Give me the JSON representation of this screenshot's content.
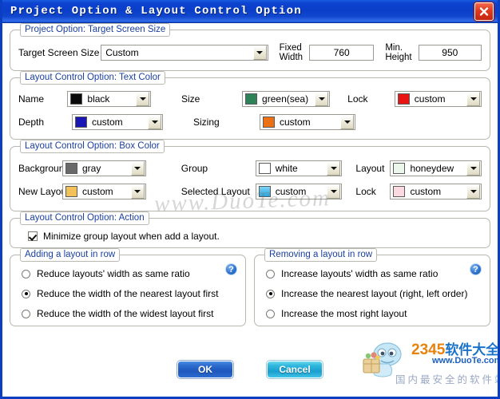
{
  "window": {
    "title": "Project Option & Layout Control Option",
    "close_icon": "close-icon"
  },
  "project_option": {
    "legend": "Project Option: Target Screen Size",
    "target_screen_size_label": "Target Screen Size",
    "target_screen_size_value": "Custom",
    "fixed_width_label": "Fixed\nWidth",
    "fixed_width_label_line1": "Fixed",
    "fixed_width_label_line2": "Width",
    "fixed_width_value": "760",
    "min_height_label_line1": "Min.",
    "min_height_label_line2": "Height",
    "min_height_value": "950"
  },
  "text_color": {
    "legend": "Layout Control Option: Text Color",
    "fields": [
      {
        "label": "Name",
        "value": "black",
        "color": "#0a0a0a"
      },
      {
        "label": "Size",
        "value": "green(sea)",
        "color": "#2e8257"
      },
      {
        "label": "Lock",
        "value": "custom",
        "color": "#e81313"
      },
      {
        "label": "Depth",
        "value": "custom",
        "color": "#1a16b4"
      },
      {
        "label": "Sizing",
        "value": "custom",
        "color": "#ec7014"
      }
    ]
  },
  "box_color": {
    "legend": "Layout Control Option: Box Color",
    "fields": [
      {
        "label": "Background",
        "value": "gray",
        "color": "#696969"
      },
      {
        "label": "Group",
        "value": "white",
        "color": "#ffffff"
      },
      {
        "label": "Layout",
        "value": "honeydew",
        "color": "#eaf7ea"
      },
      {
        "label": "New Layout",
        "value": "custom",
        "color": "#f2c159"
      },
      {
        "label": "Selected Layout",
        "value": "custom",
        "color": "#46b4e8"
      },
      {
        "label": "Lock",
        "value": "custom",
        "color": "#fadae0"
      }
    ]
  },
  "action": {
    "legend": "Layout Control Option: Action",
    "checkbox_label": "Minimize group layout when add a layout.",
    "checkbox_checked": true
  },
  "adding_group": {
    "legend": "Adding a layout in row",
    "help_icon_label": "?",
    "options": [
      "Reduce layouts' width as same ratio",
      "Reduce the width of the nearest layout first",
      "Reduce the width of the widest layout first"
    ],
    "selected_index": 1
  },
  "removing_group": {
    "legend": "Removing a layout in row",
    "help_icon_label": "?",
    "options": [
      "Increase layouts' width as same ratio",
      "Increase the nearest layout (right, left order)",
      "Increase the most right layout"
    ],
    "selected_index": 1
  },
  "buttons": {
    "ok": "OK",
    "cancel": "Cancel"
  },
  "watermark": {
    "center_text": "www.DuoTe.com",
    "brand_number": "2345",
    "brand_cn": "软件大全",
    "url": "www.DuoTe.com",
    "slogan": "国内最安全的软件站"
  },
  "colors": {
    "titlebar_blue": "#0b3fc9",
    "legend_text": "#1a3f9e",
    "ok_button": "#1d57bc",
    "cancel_button": "#1a9ed0"
  }
}
